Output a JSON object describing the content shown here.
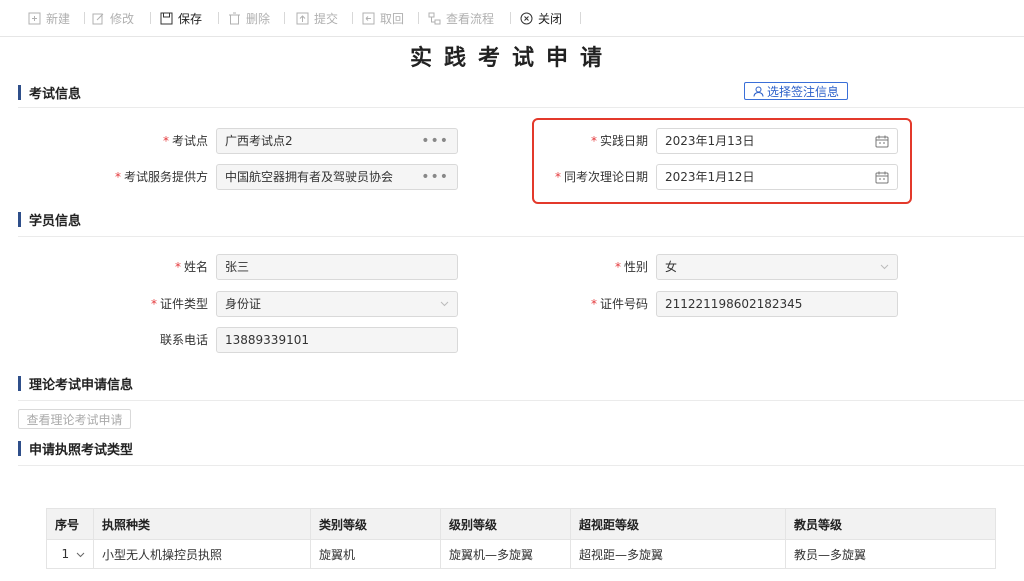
{
  "toolbar": {
    "new": "新建",
    "edit": "修改",
    "save": "保存",
    "delete": "删除",
    "submit": "提交",
    "retrieve": "取回",
    "view_flow": "查看流程",
    "close": "关闭"
  },
  "title": "实践考试申请",
  "exam_info": {
    "section": "考试信息",
    "select_sign_btn": "选择签注信息",
    "exam_site_label": "考试点",
    "exam_site_value": "广西考试点2",
    "provider_label": "考试服务提供方",
    "provider_value": "中国航空器拥有者及驾驶员协会",
    "practice_date_label": "实践日期",
    "practice_date_value": "2023年1月13日",
    "theory_date_label": "同考次理论日期",
    "theory_date_value": "2023年1月12日"
  },
  "student_info": {
    "section": "学员信息",
    "name_label": "姓名",
    "name_value": "张三",
    "gender_label": "性别",
    "gender_value": "女",
    "id_type_label": "证件类型",
    "id_type_value": "身份证",
    "id_no_label": "证件号码",
    "id_no_value": "211221198602182345",
    "phone_label": "联系电话",
    "phone_value": "13889339101"
  },
  "theory_info": {
    "section": "理论考试申请信息",
    "view_btn": "查看理论考试申请"
  },
  "license_type": {
    "section": "申请执照考试类型",
    "columns": [
      "序号",
      "执照种类",
      "类别等级",
      "级别等级",
      "超视距等级",
      "教员等级"
    ],
    "rows": [
      [
        "1",
        "小型无人机操控员执照",
        "旋翼机",
        "旋翼机—多旋翼",
        "超视距—多旋翼",
        "教员—多旋翼"
      ]
    ]
  },
  "colors": {
    "accent": "#2b5fc9",
    "required": "#e4393c",
    "highlight": "#e3392b",
    "section_bar": "#2f4f8a"
  }
}
